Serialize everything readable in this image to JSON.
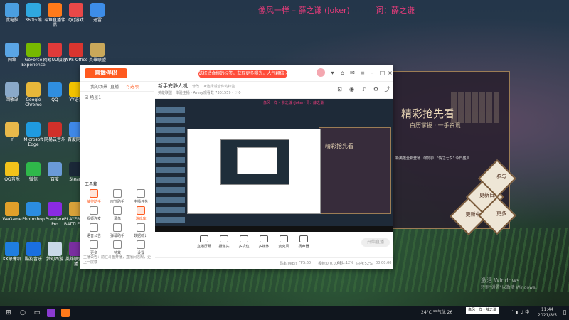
{
  "wallpaper": {
    "lyric_left": "像风一样 – 薛之谦 (Joker)",
    "lyric_right": "词：薛之谦",
    "poster_title": "精彩抢先看",
    "poster_sub": "白历掌握 · 一手资讯",
    "poster_text": "新英雄全新登场 《御剑》 \"情之七夕\" 今日盛启 ……",
    "poster_buttons": [
      "更新中",
      "更新日志",
      "参与",
      "更多"
    ],
    "watermark_line1": "激活 Windows",
    "watermark_line2": "转到\"设置\"以激活 Windows。"
  },
  "desktop_icons": [
    {
      "label": "此电脑",
      "color": "#4a9ee0"
    },
    {
      "label": "360压缩",
      "color": "#2fa8e0"
    },
    {
      "label": "斗鱼直播伴侣",
      "color": "#ff7a1a"
    },
    {
      "label": "QQ游戏",
      "color": "#e94848"
    },
    {
      "label": "迅雷",
      "color": "#3d8de8"
    },
    {
      "label": "网络",
      "color": "#5aa5e5"
    },
    {
      "label": "GeForce Experience",
      "color": "#76b900"
    },
    {
      "label": "网易UU加速",
      "color": "#e03a3a"
    },
    {
      "label": "WPS Office",
      "color": "#d9352f"
    },
    {
      "label": "英雄联盟",
      "color": "#c9a85a"
    },
    {
      "label": "回收站",
      "color": "#8aa9c9"
    },
    {
      "label": "Google Chrome",
      "color": "#e8b73a"
    },
    {
      "label": "QQ",
      "color": "#2f8ee0"
    },
    {
      "label": "YY语音",
      "color": "#f2c200"
    },
    {
      "label": "",
      "color": "#e0e0e0"
    },
    {
      "label": "Y",
      "color": "#e8b84a"
    },
    {
      "label": "Microsoft Edge",
      "color": "#1f9be0"
    },
    {
      "label": "网易云音乐",
      "color": "#d0302a"
    },
    {
      "label": "百度网盘",
      "color": "#3f88e8"
    },
    {
      "label": "",
      "color": "#5aa0e5"
    },
    {
      "label": "QQ音乐",
      "color": "#f2c21a"
    },
    {
      "label": "微信",
      "color": "#2fb84a"
    },
    {
      "label": "百度",
      "color": "#6a9ad8"
    },
    {
      "label": "Steam",
      "color": "#1b2838"
    },
    {
      "label": "微星",
      "color": "#3a6ea8"
    },
    {
      "label": "WeGame",
      "color": "#e0a02a"
    },
    {
      "label": "Photoshop",
      "color": "#2b8de0"
    },
    {
      "label": "Premiere Pro",
      "color": "#8a2be2"
    },
    {
      "label": "PLAYERUNKNOWN'S BATTLEGROUNDS",
      "color": "#d9a23a"
    },
    {
      "label": "iQIYI",
      "color": "#3fc04a"
    },
    {
      "label": "KK录像机",
      "color": "#1f7ee0"
    },
    {
      "label": "酷狗音乐",
      "color": "#1a6fe0"
    },
    {
      "label": "梦幻西游",
      "color": "#c9d8e8"
    },
    {
      "label": "英雄联盟直播",
      "color": "#7a2fa0"
    },
    {
      "label": "PlanetVoice",
      "color": "#4a6ea8"
    }
  ],
  "app": {
    "logo": "直播伴侣",
    "notice": "选择适合你的标签，获取更多曝光，人气翻倍 ›",
    "sidebar_tabs": [
      "我的场景",
      "直播",
      "可选项"
    ],
    "scene_label": "☑ 场景1",
    "toolbox_title": "工具箱",
    "tools": [
      {
        "label": "抽奖助手",
        "hot": true
      },
      {
        "label": "房管助手",
        "hot": false
      },
      {
        "label": "主播任务",
        "hot": false
      },
      {
        "label": "视频连麦",
        "hot": false
      },
      {
        "label": "录像",
        "hot": false
      },
      {
        "label": "游戏库",
        "hot": true
      },
      {
        "label": "语音公告",
        "hot": false
      },
      {
        "label": "弹幕助手",
        "hot": false
      },
      {
        "label": "数据统计",
        "hot": false
      },
      {
        "label": "更多",
        "hot": false
      },
      {
        "label": "特效",
        "hot": false
      },
      {
        "label": "设置",
        "hot": false
      }
    ],
    "sidebar_footer": "主播公告：前往斗鱼开播，直播间违规，更上一层楼",
    "room_title": "新手安静人机",
    "room_edit": "修改",
    "room_tag": "#选择适合你的标签",
    "room_sub": "英雄联盟 · 体验主播 · Avery观看数 7301559 · ♡ 0",
    "preview_lyric": "像风一样 – 薛之谦 (Joker)   词：薛之谦",
    "preview_poster_title": "精彩抢先看",
    "controls": [
      "直播屏幕",
      "摄像头",
      "多机位",
      "多媒体",
      "麦克风",
      "扬声器"
    ],
    "go_live": "开始直播",
    "status": [
      "码率:0kb/s",
      "FPS:60",
      "丢帧:0(0.00%)",
      "CPU:12%",
      "内存:52%",
      "00:00:00"
    ]
  },
  "taskbar": {
    "weather": "24°C 空气优 26",
    "tooltip": "像风一样 - 薛之谦",
    "time": "11:44",
    "date": "2021/8/5"
  }
}
